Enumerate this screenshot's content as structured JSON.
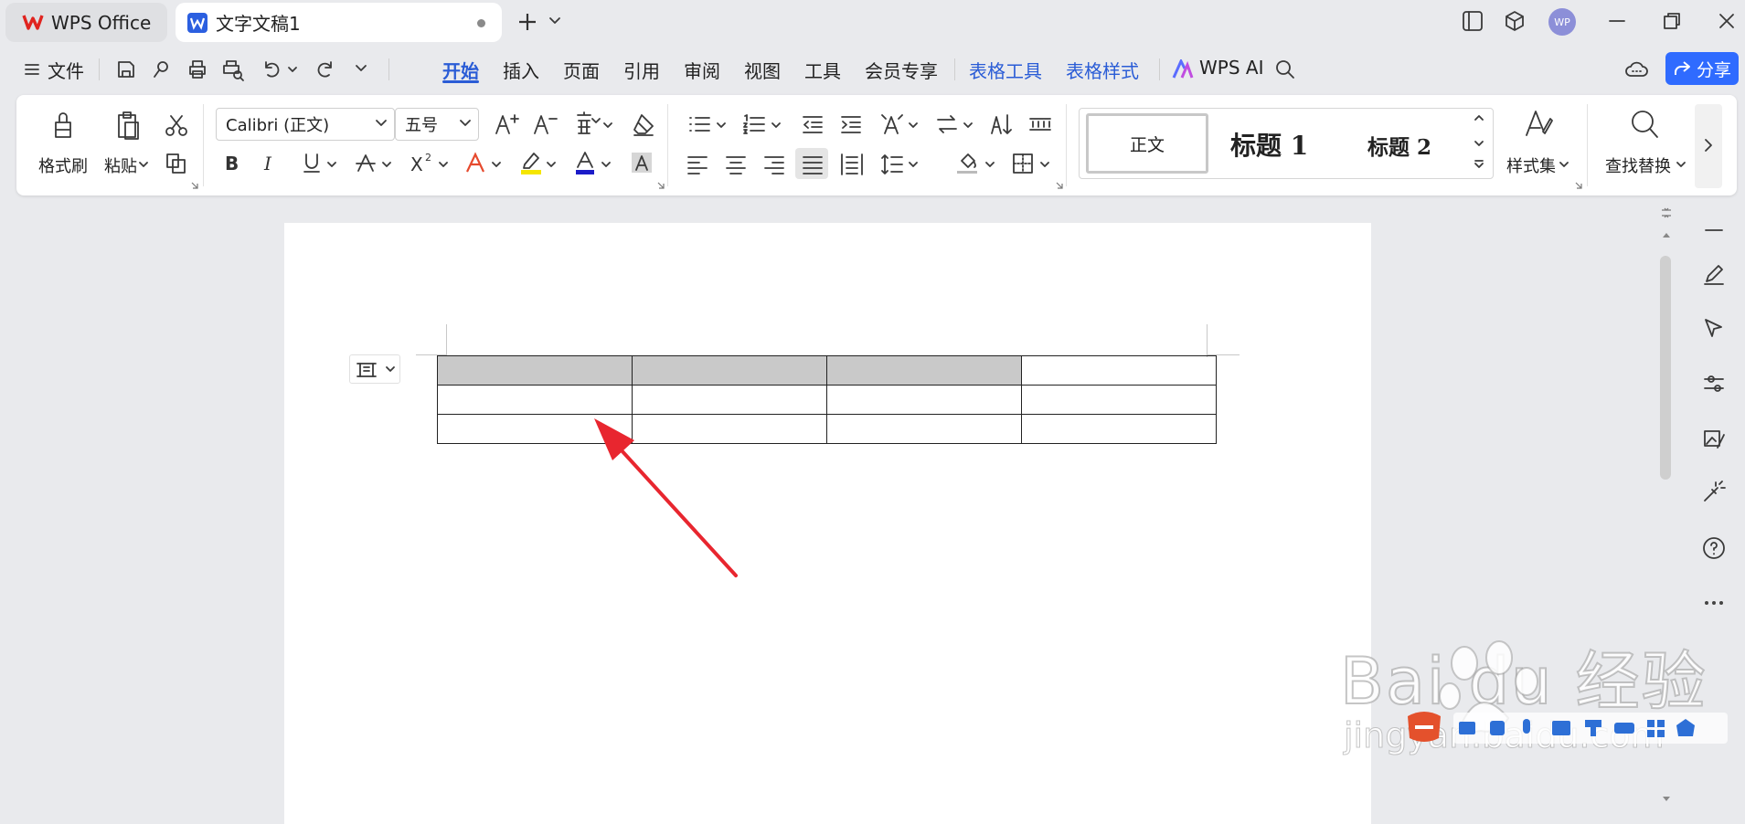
{
  "titlebar": {
    "tabs": [
      {
        "label": "WPS Office"
      },
      {
        "label": "文字文稿1"
      }
    ],
    "avatar_text": "WP"
  },
  "menubar": {
    "file_label": "文件",
    "tabs": [
      "开始",
      "插入",
      "页面",
      "引用",
      "审阅",
      "视图",
      "工具",
      "会员专享",
      "表格工具",
      "表格样式"
    ],
    "active_tab": "开始",
    "ai_label": "WPS AI",
    "share_label": "分享"
  },
  "ribbon": {
    "format_painter_label": "格式刷",
    "paste_label": "粘贴",
    "font_name": "Calibri (正文)",
    "font_size": "五号",
    "styles": {
      "normal": "正文",
      "heading1": "标题 1",
      "heading2": "标题 2"
    },
    "style_set_label": "样式集",
    "find_replace_label": "查找替换"
  },
  "document": {
    "table": {
      "rows": 3,
      "cols": 4,
      "shaded_header_cells": 3
    }
  },
  "watermark": {
    "brand": "Bai du 经验",
    "url": "jingyan.baidu.com"
  },
  "colors": {
    "accent": "#2a5cd6",
    "share_button": "#2f6bff",
    "arrow": "#e8262f",
    "header_cell": "#c9c9c9",
    "highlight": "#f5e600",
    "font_color": "#1b1bc8"
  }
}
